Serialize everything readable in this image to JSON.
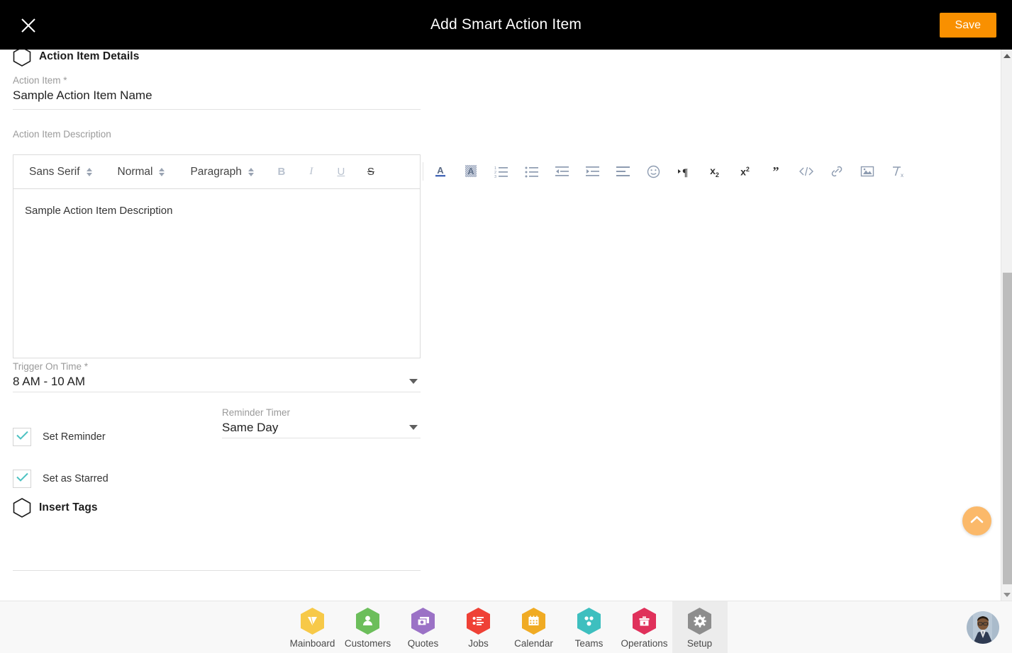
{
  "header": {
    "title": "Add Smart Action Item",
    "close_icon": "close-icon",
    "save_label": "Save"
  },
  "sections": {
    "details": {
      "title": "Action Item Details",
      "icon": "hexagon-outline-icon"
    },
    "tags": {
      "title": "Insert Tags",
      "icon": "hexagon-outline-icon"
    }
  },
  "fields": {
    "action_item": {
      "label": "Action Item *",
      "value": "Sample Action Item Name"
    },
    "description": {
      "label": "Action Item Description",
      "value": "Sample Action Item Description"
    },
    "trigger_on_time": {
      "label": "Trigger On Time *",
      "value": "8 AM - 10 AM"
    },
    "reminder_timer": {
      "label": "Reminder Timer",
      "value": "Same Day"
    }
  },
  "checkboxes": [
    {
      "label": "Set Reminder",
      "checked": true
    },
    {
      "label": "Set as Starred",
      "checked": true
    }
  ],
  "editor": {
    "pickers": [
      {
        "name": "font-picker",
        "value": "Sans Serif"
      },
      {
        "name": "size-picker",
        "value": "Normal"
      },
      {
        "name": "block-picker",
        "value": "Paragraph"
      }
    ],
    "inline_buttons": [
      {
        "name": "bold-icon",
        "glyph": "B"
      },
      {
        "name": "italic-icon",
        "glyph": "I"
      },
      {
        "name": "underline-icon",
        "glyph": "U"
      },
      {
        "name": "strike-icon",
        "glyph": "S"
      }
    ],
    "overflow_icons": [
      "text-color-icon",
      "background-color-icon",
      "ordered-list-icon",
      "bullet-list-icon",
      "outdent-icon",
      "indent-icon",
      "align-icon",
      "emoji-icon",
      "text-direction-icon",
      "subscript-icon",
      "superscript-icon",
      "blockquote-icon",
      "code-block-icon",
      "link-icon",
      "image-icon",
      "clear-format-icon"
    ]
  },
  "fab": {
    "name": "scroll-to-top-button",
    "icon": "chevron-up-icon"
  },
  "scrollbar": {
    "up_arrow": "scroll-up-arrow-icon",
    "down_arrow": "scroll-down-arrow-icon"
  },
  "bottom_nav": {
    "items": [
      {
        "label": "Mainboard",
        "icon": "mainboard-icon",
        "color": "#f7c948",
        "active": false
      },
      {
        "label": "Customers",
        "icon": "customers-icon",
        "color": "#6cbe5b",
        "active": false
      },
      {
        "label": "Quotes",
        "icon": "quotes-icon",
        "color": "#9b72c6",
        "active": false
      },
      {
        "label": "Jobs",
        "icon": "jobs-icon",
        "color": "#ef4136",
        "active": false
      },
      {
        "label": "Calendar",
        "icon": "calendar-icon",
        "color": "#f0ab24",
        "active": false
      },
      {
        "label": "Teams",
        "icon": "teams-icon",
        "color": "#3ebfbf",
        "active": false
      },
      {
        "label": "Operations",
        "icon": "operations-icon",
        "color": "#e0315b",
        "active": false
      },
      {
        "label": "Setup",
        "icon": "setup-icon",
        "color": "#8d8d8d",
        "active": true
      }
    ],
    "avatar": "user-avatar"
  },
  "colors": {
    "accent_orange": "#f99000",
    "fab_orange": "#fbb96a",
    "check_teal": "#4dc2c2",
    "header_bg": "#000000"
  }
}
